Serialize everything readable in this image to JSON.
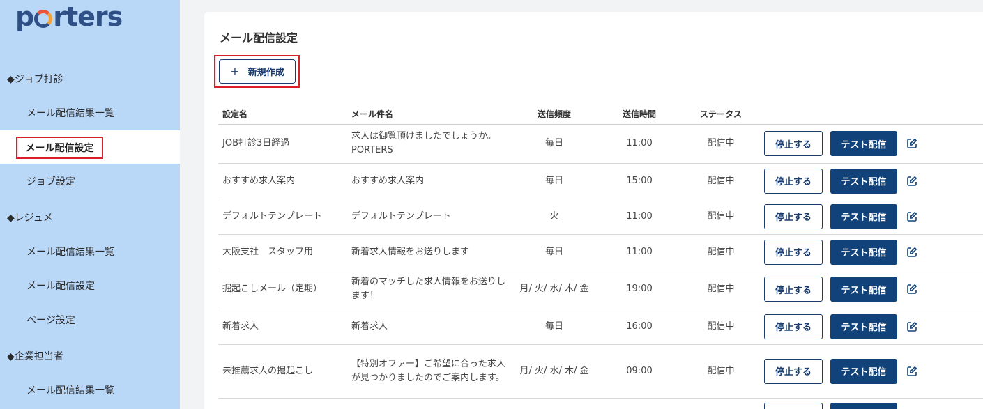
{
  "brand": {
    "logo_pre": "p",
    "logo_post": "rters"
  },
  "sidebar": {
    "sections": [
      {
        "title": "◆ジョブ打診",
        "items": [
          "メール配信結果一覧",
          "メール配信設定",
          "ジョブ設定"
        ]
      },
      {
        "title": "◆レジュメ",
        "items": [
          "メール配信結果一覧",
          "メール配信設定",
          "ページ設定"
        ]
      },
      {
        "title": "◆企業担当者",
        "items": [
          "メール配信結果一覧"
        ]
      }
    ],
    "active_item": "メール配信設定"
  },
  "main": {
    "title": "メール配信設定",
    "new_button_icon": "plus-icon",
    "new_button_label": "新規作成",
    "table": {
      "headers": [
        "設定名",
        "メール件名",
        "送信頻度",
        "送信時間",
        "ステータス"
      ],
      "stop_label": "停止する",
      "test_label": "テスト配信",
      "rows": [
        {
          "name": "JOB打診3日経過",
          "subject": "求人は御覧頂けましたでしょうか。　PORTERS",
          "frequency": "毎日",
          "time": "11:00",
          "status": "配信中"
        },
        {
          "name": "おすすめ求人案内",
          "subject": "おすすめ求人案内",
          "frequency": "毎日",
          "time": "15:00",
          "status": "配信中"
        },
        {
          "name": "デフォルトテンプレート",
          "subject": "デフォルトテンプレート",
          "frequency": "火",
          "time": "11:00",
          "status": "配信中"
        },
        {
          "name": "大阪支社　スタッフ用",
          "subject": "新着求人情報をお送りします",
          "frequency": "毎日",
          "time": "11:00",
          "status": "配信中"
        },
        {
          "name": "掘起こしメール（定期）",
          "subject": "新着のマッチした求人情報をお送りします！",
          "frequency": "月/ 火/ 水/ 木/ 金",
          "time": "19:00",
          "status": "配信中"
        },
        {
          "name": "新着求人",
          "subject": "新着求人",
          "frequency": "毎日",
          "time": "16:00",
          "status": "配信中"
        },
        {
          "name": "未推薦求人の掘起こし",
          "subject": "【特別オファー】ご希望に合った求人が見つかりましたのでご案内します。",
          "frequency": "月/ 火/ 水/ 木/ 金",
          "time": "09:00",
          "status": "配信中"
        }
      ]
    }
  },
  "colors": {
    "sidebar_bg": "#b9d7f7",
    "primary": "#11427a",
    "highlight": "#d9202a"
  }
}
